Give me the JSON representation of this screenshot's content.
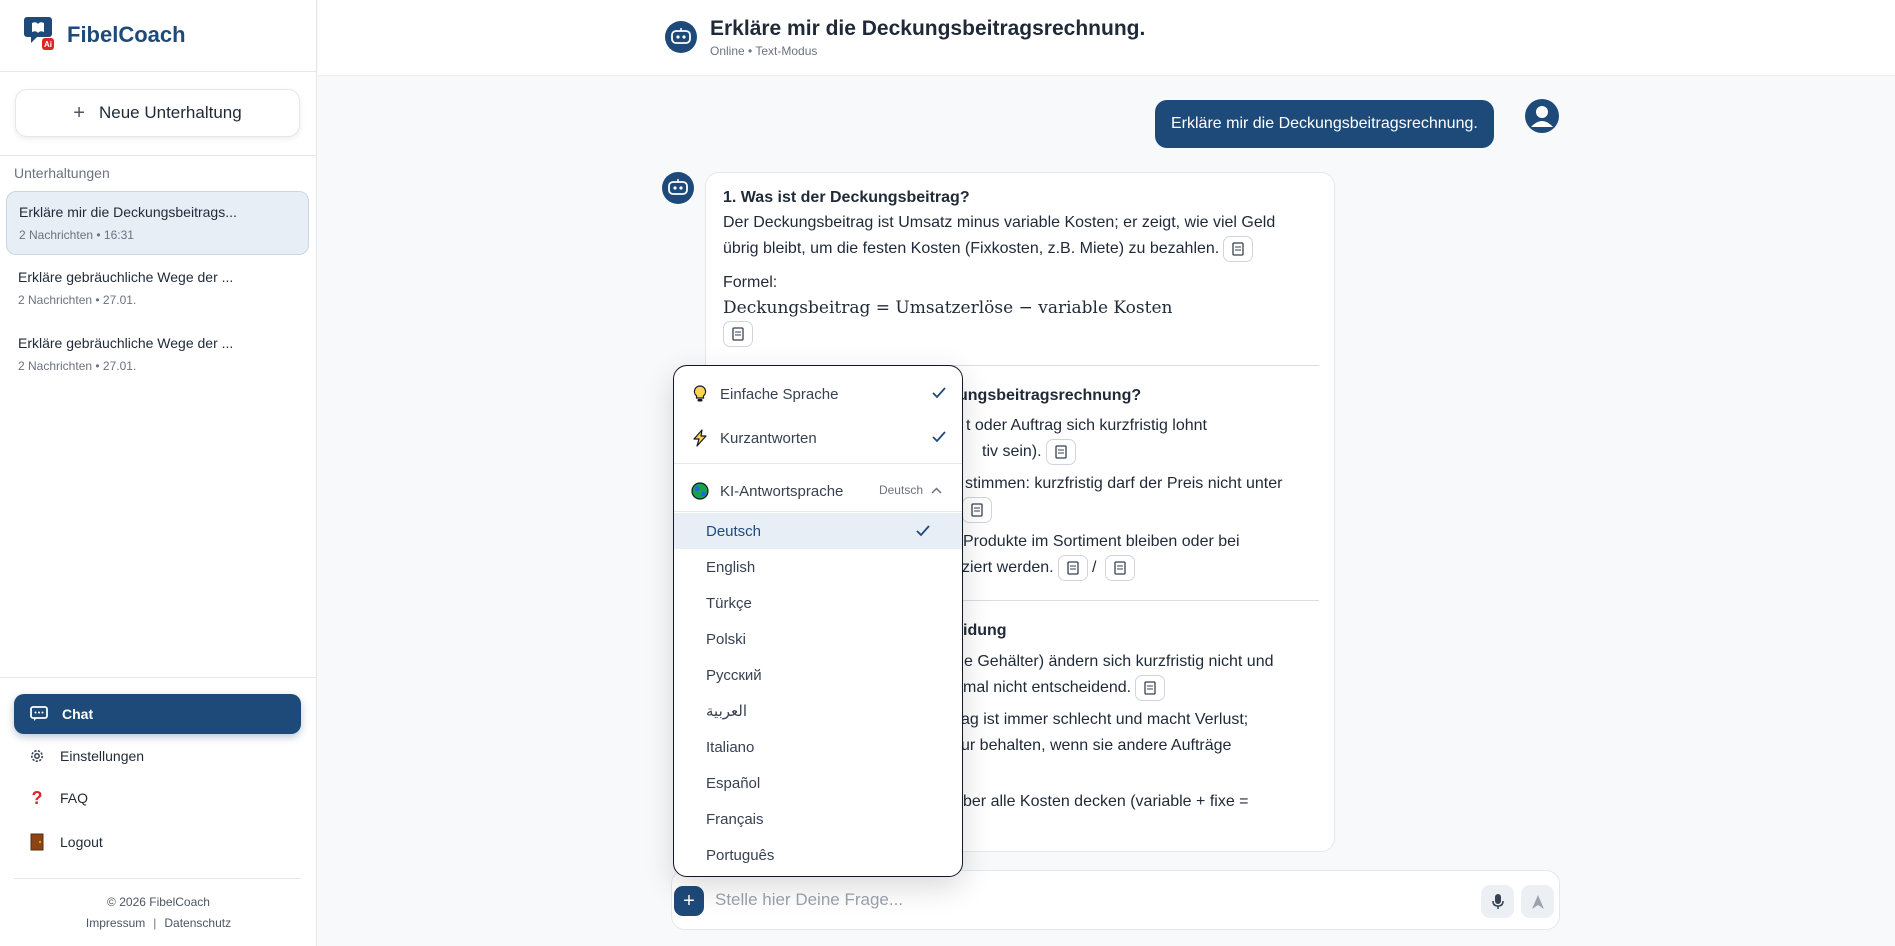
{
  "brand": {
    "name": "FibelCoach",
    "logo_icon": "chat-bubble-ai-icon",
    "logo_badge": "Ai"
  },
  "sidebar": {
    "new_chat_label": "Neue Unterhaltung",
    "section_label": "Unterhaltungen",
    "conversations": [
      {
        "title": "Erkläre mir die Deckungsbeitrags...",
        "meta": "2 Nachrichten • 16:31",
        "active": true
      },
      {
        "title": "Erkläre gebräuchliche Wege der ...",
        "meta": "2 Nachrichten • 27.01.",
        "active": false
      },
      {
        "title": "Erkläre gebräuchliche Wege der ...",
        "meta": "2 Nachrichten • 27.01.",
        "active": false
      }
    ],
    "nav": [
      {
        "label": "Chat",
        "icon": "chat-icon",
        "active": true
      },
      {
        "label": "Einstellungen",
        "icon": "gear-icon",
        "active": false
      },
      {
        "label": "FAQ",
        "icon": "question-icon",
        "active": false
      },
      {
        "label": "Logout",
        "icon": "door-icon",
        "active": false
      }
    ],
    "footer": {
      "copyright": "© 2026 FibelCoach",
      "links": [
        "Impressum",
        "Datenschutz"
      ]
    }
  },
  "header": {
    "title": "Erkläre mir die Deckungsbeitragsrechnung.",
    "status": "Online • Text-Modus"
  },
  "chat": {
    "user_message": "Erkläre mir die Deckungsbeitragsrechnung.",
    "bot": {
      "s1_title": "1. Was ist der Deckungsbeitrag?",
      "s1_line1": "Der Deckungsbeitrag ist Umsatz minus variable Kosten; er zeigt, wie viel Geld",
      "s1_line2": "übrig bleibt, um die festen Kosten (Fixkosten, z.B. Miete) zu bezahlen.",
      "formula_label": "Formel:",
      "formula": "Deckungsbeitrag = Umsatzerlöse − variable Kosten",
      "s2_title_visible": "ungsbeitragsrechnung?",
      "s2_l1": "t oder Auftrag sich kurzfristig lohnt",
      "s2_l2": "tiv sein).",
      "s2_l3": "stimmen: kurzfristig darf der Preis nicht unter",
      "s2_l4": "Produkte im Sortiment bleiben oder bei",
      "s2_l5": "ziert werden.",
      "s2_slash": "/",
      "s3_title_visible": "idung",
      "s3_l1": "e Gehälter) ändern sich kurzfristig nicht und",
      "s3_l2": "mal nicht entscheidend.",
      "s3_l3": "ag ist immer schlecht und macht Verlust;",
      "s3_l4": "ur behalten, wenn sie andere Aufträge",
      "s3_l5": "ber alle Kosten decken (variable + fixe ="
    }
  },
  "composer": {
    "placeholder": "Stelle hier Deine Frage..."
  },
  "popover": {
    "options": [
      {
        "label": "Einfache Sprache",
        "icon": "lightbulb-icon",
        "checked": true
      },
      {
        "label": "Kurzantworten",
        "icon": "lightning-icon",
        "checked": true
      }
    ],
    "language_label": "KI-Antwortsprache",
    "language_icon": "globe-icon",
    "language_selected": "Deutsch",
    "languages": [
      "Deutsch",
      "English",
      "Türkçe",
      "Polski",
      "Русский",
      "العربية",
      "Italiano",
      "Español",
      "Français",
      "Português"
    ]
  },
  "colors": {
    "primary": "#1e4a7a",
    "active_bg": "#e8eef6"
  }
}
